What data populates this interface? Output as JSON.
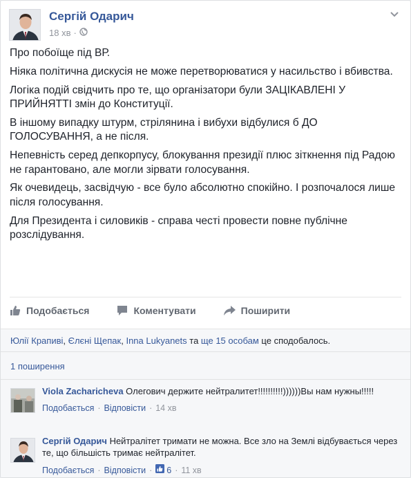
{
  "post": {
    "author": "Сергій Одарич",
    "time": "18 хв",
    "paragraphs": [
      "Про побоїще під ВР.",
      "Ніяка політична дискусія не може перетворюватися у насильство і вбивства.",
      "Логіка подій свідчить про те, що організатори були ЗАЦІКАВЛЕНІ У ПРИЙНЯТТІ змін до Конституції.",
      "В іншому випадку штурм, стрілянина і вибухи відбулися б ДО ГОЛОСУВАННЯ, а не після.",
      "Непевність серед депкорпусу, блокування президії плюс зіткнення під Радою не гарантовано, але могли зірвати голосування.",
      "Як очевидець, засвідчую - все було абсолютно спокійно. І розпочалося лише після голосування.",
      "Для Президента і силовиків - справа честі провести повне публічне розслідування."
    ]
  },
  "actions": {
    "like": "Подобається",
    "comment": "Коментувати",
    "share": "Поширити"
  },
  "likes": {
    "person1": "Юлії Крапиві",
    "sep1": ", ",
    "person2": "Єлєні Щепак",
    "sep2": ", ",
    "person3": "Inna Lukyanets",
    "and": " та ",
    "others": "ще 15 особам",
    "suffix": " це сподобалось."
  },
  "shares": "1 поширення",
  "comments": [
    {
      "author": "Viola Zacharicheva",
      "text": " Олегович держите нейтралитет!!!!!!!!!!))))))Вы нам нужны!!!!!",
      "like": "Подобається",
      "reply": "Відповісти",
      "time": "14 хв"
    },
    {
      "author": "Сергій Одарич",
      "text": " Нейтралітет тримати не можна. Все зло на Землі відбувається через те, що більшість тримає нейтралітет.",
      "like": "Подобається",
      "reply": "Відповісти",
      "likes_count": "6",
      "time": "11 хв"
    }
  ],
  "icons": {
    "globe": "globe-icon",
    "chevron": "chevron-down-icon",
    "like": "thumbs-up-icon",
    "comment": "comment-icon",
    "share": "share-arrow-icon"
  },
  "colors": {
    "link": "#365899",
    "text": "#1d2129",
    "muted": "#90949c",
    "action": "#616770",
    "panel": "#f6f7f9"
  }
}
